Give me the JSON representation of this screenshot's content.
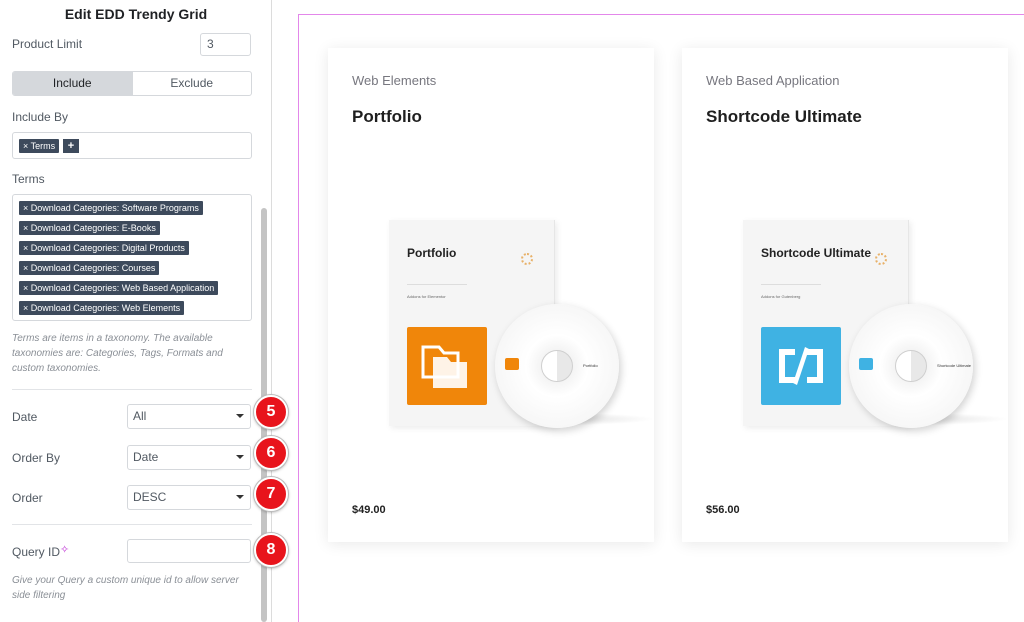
{
  "panel": {
    "title": "Edit EDD Trendy Grid",
    "product_limit": {
      "label": "Product Limit",
      "value": "3"
    },
    "include_toggle": {
      "include": "Include",
      "exclude": "Exclude",
      "active": "Include"
    },
    "include_by": {
      "label": "Include By",
      "tags": [
        "× Terms"
      ],
      "add": "+"
    },
    "terms": {
      "label": "Terms",
      "tags": [
        "× Download Categories: Software Programs",
        "× Download Categories: E-Books",
        "× Download Categories: Digital Products",
        "× Download Categories: Courses",
        "× Download Categories: Web Based Application",
        "× Download Categories: Web Elements"
      ],
      "help": "Terms are items in a taxonomy. The available taxonomies are: Categories, Tags, Formats and custom taxonomies."
    },
    "date": {
      "label": "Date",
      "value": "All",
      "badge": "5"
    },
    "order_by": {
      "label": "Order By",
      "value": "Date",
      "badge": "6"
    },
    "order": {
      "label": "Order",
      "value": "DESC",
      "badge": "7"
    },
    "query_id": {
      "label": "Query ID",
      "value": "",
      "badge": "8",
      "help": "Give your Query a custom unique id to allow server side filtering"
    }
  },
  "products": [
    {
      "category": "Web Elements",
      "title": "Portfolio",
      "price": "$49.00",
      "box_title": "Portfolio",
      "box_sub": "Addons for Elementor",
      "disc_label": "Portfolio",
      "icon": "folder-icon",
      "icon_color": "#f0860a"
    },
    {
      "category": "Web Based Application",
      "title": "Shortcode Ultimate",
      "price": "$56.00",
      "box_title": "Shortcode Ultimate",
      "box_sub": "Addons for Gutenberg",
      "disc_label": "Shortcode Ultimate",
      "icon": "shortcode-icon",
      "icon_color": "#3fb2e3"
    }
  ],
  "colors": {
    "accent": "#e8141c",
    "canvas_outline": "#e387ea",
    "tag_bg": "#3d4a5c"
  }
}
